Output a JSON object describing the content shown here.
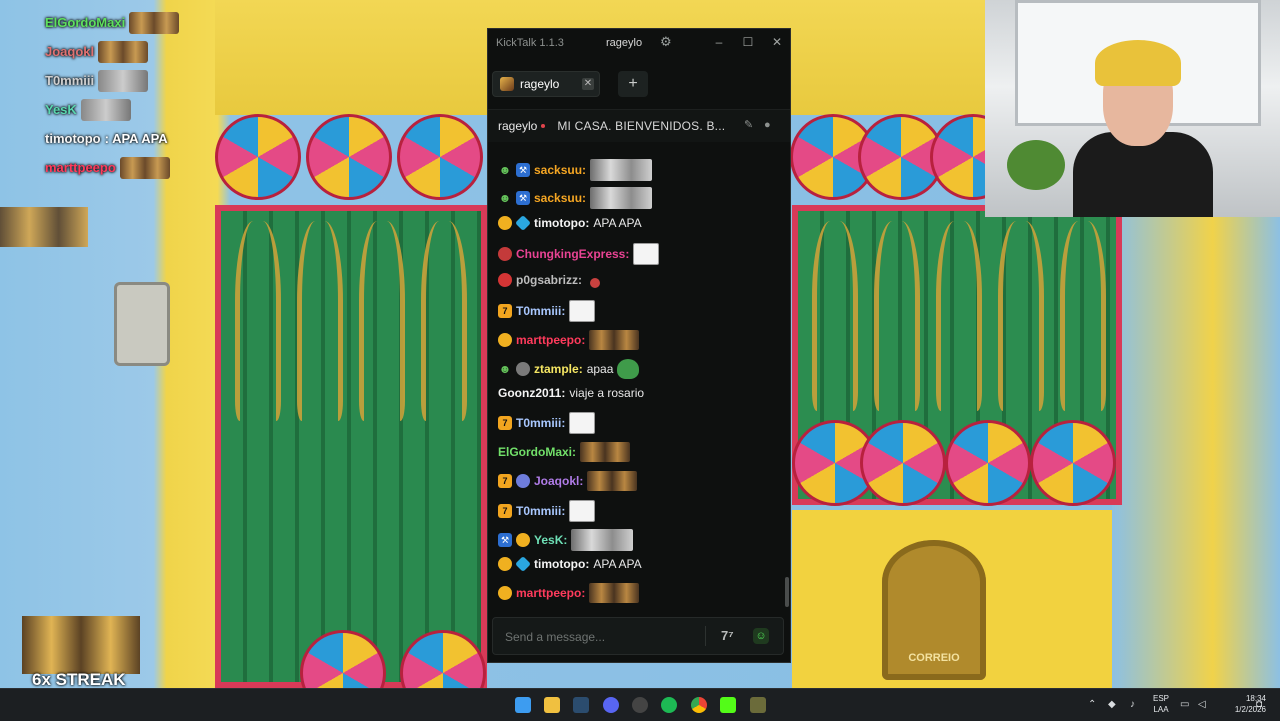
{
  "overlay_chat": {
    "rows": [
      {
        "user": "ElGordoMaxi",
        "text": "",
        "color": "#5ee05e"
      },
      {
        "user": "Joaqokl",
        "text": "",
        "color": "#e07272"
      },
      {
        "user": "T0mmiii",
        "text": "",
        "color": "#d0d0d0"
      },
      {
        "user": "YesK",
        "text": "",
        "color": "#5ad8b0"
      },
      {
        "user": "timotopo",
        "text": "APA APA",
        "color": "#f5f5f5"
      },
      {
        "user": "marttpeepo",
        "text": "",
        "color": "#ff3b5c"
      }
    ],
    "streak": "6x STREAK"
  },
  "kicktalk": {
    "app_title": "KickTalk 1.1.3",
    "account": "rageylo",
    "tab": {
      "label": "rageylo"
    },
    "add_tab": "+",
    "channel": {
      "name": "rageylo",
      "title": "MI CASA. BIENVENIDOS. B..."
    },
    "messages": [
      {
        "user": "sacksuu",
        "sep": ":",
        "text": "",
        "color": "#f5a623",
        "badges": [
          "alien",
          "hammer"
        ],
        "emote": "cat"
      },
      {
        "user": "sacksuu",
        "sep": ":",
        "text": "",
        "color": "#f5a623",
        "badges": [
          "alien",
          "hammer"
        ],
        "emote": "cat"
      },
      {
        "user": "timotopo",
        "sep": ":",
        "text": "APA APA",
        "color": "#f5f5f5",
        "badges": [
          "coin",
          "gem"
        ],
        "emote": ""
      },
      {
        "user": "ChungkingExpress",
        "sep": ":",
        "text": "",
        "color": "#e84393",
        "badges": [
          "chung"
        ],
        "emote": "doodle"
      },
      {
        "user": "p0gsabrizz",
        "sep": ":",
        "text": "",
        "color": "#bdbdbd",
        "badges": [
          "red"
        ],
        "emote": "red"
      },
      {
        "user": "T0mmiii",
        "sep": ":",
        "text": "",
        "color": "#a9c8ff",
        "badges": [
          "seven"
        ],
        "emote": "doodle"
      },
      {
        "user": "marttpeepo",
        "sep": ":",
        "text": "",
        "color": "#ff3b5c",
        "badges": [
          "coin"
        ],
        "emote": "minion"
      },
      {
        "user": "ztample",
        "sep": ":",
        "text": "apaa",
        "color": "#f5e663",
        "badges": [
          "alien",
          "gray"
        ],
        "emote": "pepe"
      },
      {
        "user": "Goonz2011",
        "sep": ":",
        "text": "viaje a rosario",
        "color": "#f5f5f5",
        "badges": [],
        "emote": ""
      },
      {
        "user": "T0mmiii",
        "sep": ":",
        "text": "",
        "color": "#a9c8ff",
        "badges": [
          "seven"
        ],
        "emote": "doodle"
      },
      {
        "user": "ElGordoMaxi",
        "sep": ":",
        "text": "",
        "color": "#72e06a",
        "badges": [],
        "emote": "minion"
      },
      {
        "user": "Joaqokl",
        "sep": ":",
        "text": "",
        "color": "#b07ce8",
        "badges": [
          "seven",
          "circle-blue"
        ],
        "emote": "minion"
      },
      {
        "user": "T0mmiii",
        "sep": ":",
        "text": "",
        "color": "#a9c8ff",
        "badges": [
          "seven"
        ],
        "emote": "doodle"
      },
      {
        "user": "YesK",
        "sep": ":",
        "text": "",
        "color": "#6ee0b6",
        "badges": [
          "hammer",
          "coin"
        ],
        "emote": "cat"
      },
      {
        "user": "timotopo",
        "sep": ":",
        "text": "APA APA",
        "color": "#f5f5f5",
        "badges": [
          "coin",
          "gem"
        ],
        "emote": ""
      },
      {
        "user": "marttpeepo",
        "sep": ":",
        "text": "",
        "color": "#ff3b5c",
        "badges": [
          "coin"
        ],
        "emote": "minion"
      }
    ],
    "input": {
      "placeholder": "Send a message..."
    },
    "accent": "#53fc18"
  },
  "background": {
    "mailbox_label": "CORREIO"
  },
  "taskbar": {
    "language": [
      "ESP",
      "LAA"
    ],
    "time": "18:34",
    "date": "1/2/2026"
  }
}
